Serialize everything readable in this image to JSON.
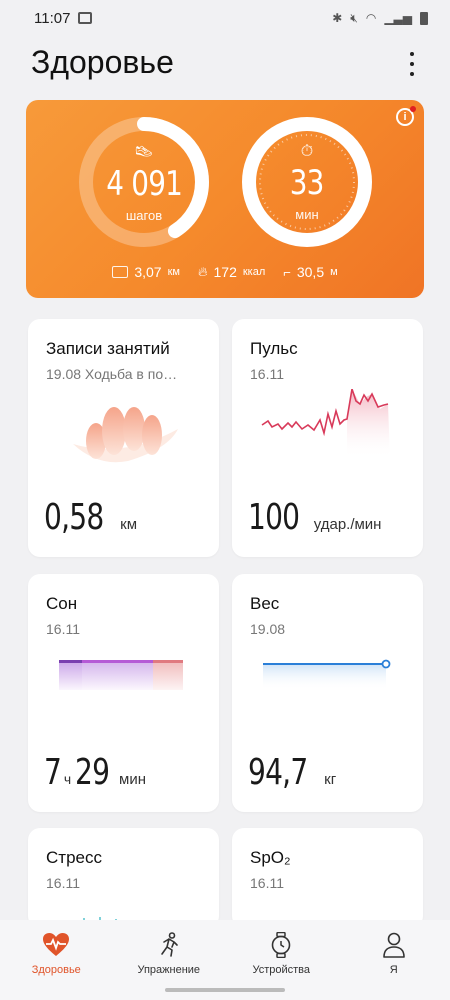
{
  "status_bar": {
    "time": "11:07"
  },
  "header": {
    "title": "Здоровье"
  },
  "activity": {
    "steps": {
      "value": "4 091",
      "unit": "шагов",
      "progress": 0.41
    },
    "minutes": {
      "value": "33",
      "unit": "мин",
      "progress": 1.0
    },
    "stats": [
      {
        "value": "3,07",
        "unit": "км",
        "icon": "distance-icon"
      },
      {
        "value": "172",
        "unit": "ккал",
        "icon": "flame-icon"
      },
      {
        "value": "30,5",
        "unit": "м",
        "icon": "stairs-icon"
      }
    ],
    "colors": {
      "start": "#f79a3a",
      "end": "#f07425"
    }
  },
  "tiles": {
    "workouts": {
      "title": "Записи занятий",
      "subtitle": "19.08 Ходьба в по…",
      "value": "0,58",
      "unit": "км"
    },
    "pulse": {
      "title": "Пульс",
      "subtitle": "16.11",
      "value": "100",
      "unit": "удар./мин"
    },
    "sleep": {
      "title": "Сон",
      "subtitle": "16.11",
      "hours": "7",
      "hours_unit": "ч",
      "minutes": "29",
      "minutes_unit": "мин"
    },
    "weight": {
      "title": "Вес",
      "subtitle": "19.08",
      "value": "94,7",
      "unit": "кг"
    },
    "stress": {
      "title": "Стресс",
      "subtitle": "16.11"
    },
    "spo2": {
      "title": "SpO₂",
      "subtitle": "16.11"
    }
  },
  "nav": {
    "items": [
      {
        "label": "Здоровье",
        "icon": "heart-pulse-icon",
        "active": true
      },
      {
        "label": "Упражнение",
        "icon": "running-icon",
        "active": false
      },
      {
        "label": "Устройства",
        "icon": "watch-icon",
        "active": false
      },
      {
        "label": "Я",
        "icon": "person-icon",
        "active": false
      }
    ]
  }
}
